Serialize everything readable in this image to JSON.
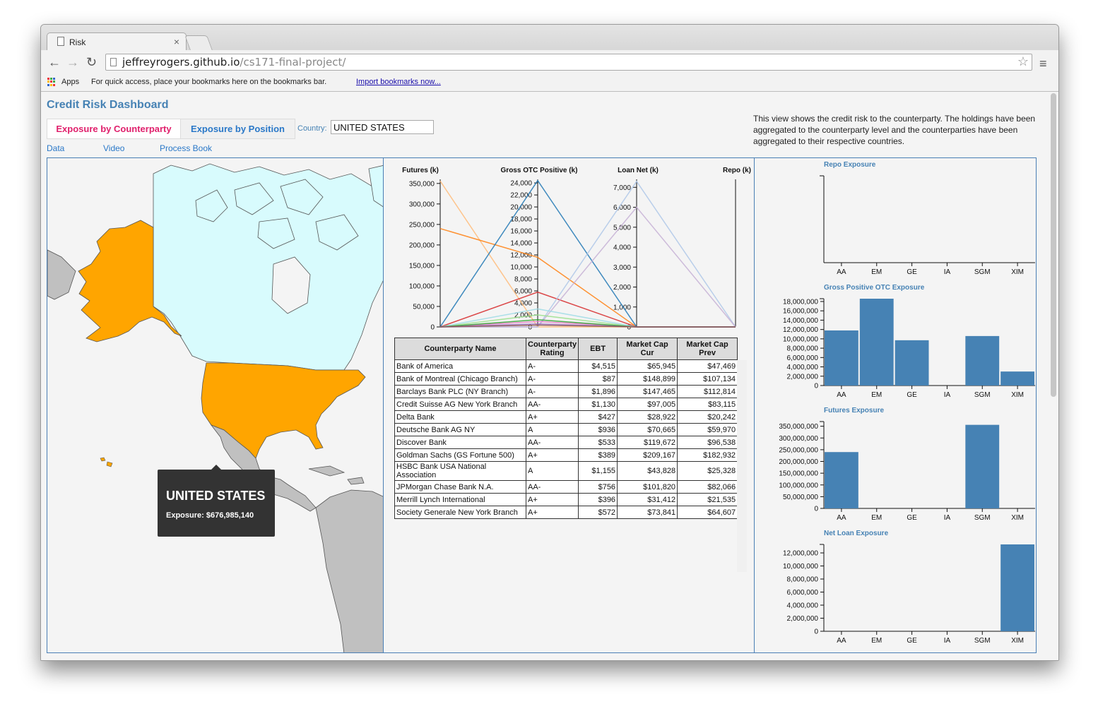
{
  "browser": {
    "tab_title": "Risk",
    "tab_close": "×",
    "url_host": "jeffreyrogers.github.io",
    "url_path": "/cs171-final-project/",
    "back_icon": "←",
    "forward_icon": "→",
    "reload_icon": "↻",
    "star_icon": "☆",
    "menu_icon": "≡",
    "apps_label": "Apps",
    "bookmarks_hint": "For quick access, place your bookmarks here on the bookmarks bar.",
    "import_link": "Import bookmarks now..."
  },
  "page": {
    "title": "Credit Risk Dashboard",
    "tab_counterparty": "Exposure by Counterparty",
    "tab_position": "Exposure by Position",
    "country_label": "Country:",
    "country_value": "UNITED STATES",
    "links": [
      "Data",
      "Video",
      "Process Book"
    ],
    "description": "This view shows the credit risk to the counterparty. The holdings have been aggregated to the counterparty level and the counterparties have been aggregated to their respective countries."
  },
  "map": {
    "highlight_color": "#ffa500",
    "canada_color": "#d8fbfd",
    "other_color": "#c0c0c0",
    "tooltip_title": "UNITED STATES",
    "tooltip_exposure": "Exposure: $676,985,140"
  },
  "table": {
    "headers": [
      "Counterparty Name",
      "Counterparty Rating",
      "EBT",
      "Market Cap Cur",
      "Market Cap Prev"
    ],
    "rows": [
      [
        "Bank of America",
        "A-",
        "$4,515",
        "$65,945",
        "$47,469"
      ],
      [
        "Bank of Montreal (Chicago Branch)",
        "A-",
        "$87",
        "$148,899",
        "$107,134"
      ],
      [
        "Barclays Bank PLC (NY Branch)",
        "A-",
        "$1,896",
        "$147,465",
        "$112,814"
      ],
      [
        "Credit Suisse AG New York Branch",
        "AA-",
        "$1,130",
        "$97,005",
        "$83,115"
      ],
      [
        "Delta Bank",
        "A+",
        "$427",
        "$28,922",
        "$20,242"
      ],
      [
        "Deutsche Bank AG NY",
        "A",
        "$936",
        "$70,665",
        "$59,970"
      ],
      [
        "Discover Bank",
        "AA-",
        "$533",
        "$119,672",
        "$96,538"
      ],
      [
        "Goldman Sachs (GS Fortune 500)",
        "A+",
        "$389",
        "$209,167",
        "$182,932"
      ],
      [
        "HSBC Bank USA National Association",
        "A",
        "$1,155",
        "$43,828",
        "$25,328"
      ],
      [
        "JPMorgan Chase Bank N.A.",
        "AA-",
        "$756",
        "$101,820",
        "$82,066"
      ],
      [
        "Merrill Lynch International",
        "A+",
        "$396",
        "$31,412",
        "$21,535"
      ],
      [
        "Society Generale New York Branch",
        "A+",
        "$572",
        "$73,841",
        "$64,607"
      ]
    ]
  },
  "chart_data": [
    {
      "type": "line",
      "subtype": "parallel-coordinates",
      "axes": [
        {
          "label": "Futures (k)",
          "ylim": [
            0,
            360000
          ],
          "ticks": [
            0,
            50000,
            100000,
            150000,
            200000,
            250000,
            300000,
            350000
          ],
          "tick_labels": [
            "0",
            "50,000",
            "100,000",
            "150,000",
            "200,000",
            "250,000",
            "300,000",
            "350,000"
          ]
        },
        {
          "label": "Gross OTC Positive (k)",
          "ylim": [
            0,
            24600
          ],
          "ticks": [
            0,
            2000,
            4000,
            6000,
            8000,
            10000,
            12000,
            14000,
            16000,
            18000,
            20000,
            22000,
            24000
          ],
          "tick_labels": [
            "0",
            "2,000",
            "4,000",
            "6,000",
            "8,000",
            "10,000",
            "12,000",
            "14,000",
            "16,000",
            "18,000",
            "20,000",
            "22,000",
            "24,000"
          ]
        },
        {
          "label": "Loan Net (k)",
          "ylim": [
            0,
            7400
          ],
          "ticks": [
            0,
            1000,
            2000,
            3000,
            4000,
            5000,
            6000,
            7000
          ],
          "tick_labels": [
            "0",
            "1,000",
            "2,000",
            "3,000",
            "4,000",
            "5,000",
            "6,000",
            "7,000"
          ]
        },
        {
          "label": "Repo (k)",
          "ylim": [
            0,
            1
          ],
          "ticks": [],
          "tick_labels": []
        }
      ],
      "lines": [
        {
          "color": "#ffbb78",
          "values": [
            356000,
            0,
            0,
            0
          ]
        },
        {
          "color": "#ff7f0e",
          "values": [
            240000,
            11600,
            0,
            0
          ]
        },
        {
          "color": "#1f77b4",
          "values": [
            0,
            24400,
            0,
            0
          ]
        },
        {
          "color": "#d62728",
          "values": [
            0,
            5800,
            0,
            0
          ]
        },
        {
          "color": "#aec7e8",
          "values": [
            0,
            0,
            7300,
            0
          ]
        },
        {
          "color": "#c5b0d5",
          "values": [
            0,
            0,
            6000,
            0
          ]
        },
        {
          "color": "#98df8a",
          "values": [
            0,
            2000,
            0,
            0
          ]
        },
        {
          "color": "#9edae5",
          "values": [
            0,
            3000,
            0,
            0
          ]
        },
        {
          "color": "#e377c2",
          "values": [
            0,
            900,
            0,
            0
          ]
        },
        {
          "color": "#2ca02c",
          "values": [
            0,
            1200,
            0,
            0
          ]
        },
        {
          "color": "#9467bd",
          "values": [
            0,
            500,
            0,
            0
          ]
        },
        {
          "color": "#8c564b",
          "values": [
            0,
            300,
            0,
            0
          ]
        }
      ]
    },
    {
      "type": "bar",
      "title": "Repo Exposure",
      "categories": [
        "AA",
        "EM",
        "GE",
        "IA",
        "SGM",
        "XIM"
      ],
      "values": [
        0,
        0,
        0,
        0,
        0,
        0
      ],
      "ylim": [
        0,
        1
      ],
      "ticks": [],
      "tick_labels": []
    },
    {
      "type": "bar",
      "title": "Gross Positive OTC Exposure",
      "categories": [
        "AA",
        "EM",
        "GE",
        "IA",
        "SGM",
        "XIM"
      ],
      "values": [
        11800000,
        18600000,
        9700000,
        0,
        10600000,
        3000000
      ],
      "ylim": [
        0,
        18600000
      ],
      "ticks": [
        0,
        2000000,
        4000000,
        6000000,
        8000000,
        10000000,
        12000000,
        14000000,
        16000000,
        18000000
      ],
      "tick_labels": [
        "0",
        "2,000,000",
        "4,000,000",
        "6,000,000",
        "8,000,000",
        "10,000,000",
        "12,000,000",
        "14,000,000",
        "16,000,000",
        "18,000,000"
      ]
    },
    {
      "type": "bar",
      "title": "Futures Exposure",
      "categories": [
        "AA",
        "EM",
        "GE",
        "IA",
        "SGM",
        "XIM"
      ],
      "values": [
        240000000,
        0,
        0,
        0,
        356000000,
        0
      ],
      "ylim": [
        0,
        370000000
      ],
      "ticks": [
        0,
        50000000,
        100000000,
        150000000,
        200000000,
        250000000,
        300000000,
        350000000
      ],
      "tick_labels": [
        "0",
        "50,000,000",
        "100,000,000",
        "150,000,000",
        "200,000,000",
        "250,000,000",
        "300,000,000",
        "350,000,000"
      ]
    },
    {
      "type": "bar",
      "title": "Net Loan Exposure",
      "categories": [
        "AA",
        "EM",
        "GE",
        "IA",
        "SGM",
        "XIM"
      ],
      "values": [
        0,
        0,
        0,
        0,
        0,
        13300000
      ],
      "ylim": [
        0,
        13300000
      ],
      "ticks": [
        0,
        2000000,
        4000000,
        6000000,
        8000000,
        10000000,
        12000000
      ],
      "tick_labels": [
        "0",
        "2,000,000",
        "4,000,000",
        "6,000,000",
        "8,000,000",
        "10,000,000",
        "12,000,000"
      ]
    }
  ]
}
